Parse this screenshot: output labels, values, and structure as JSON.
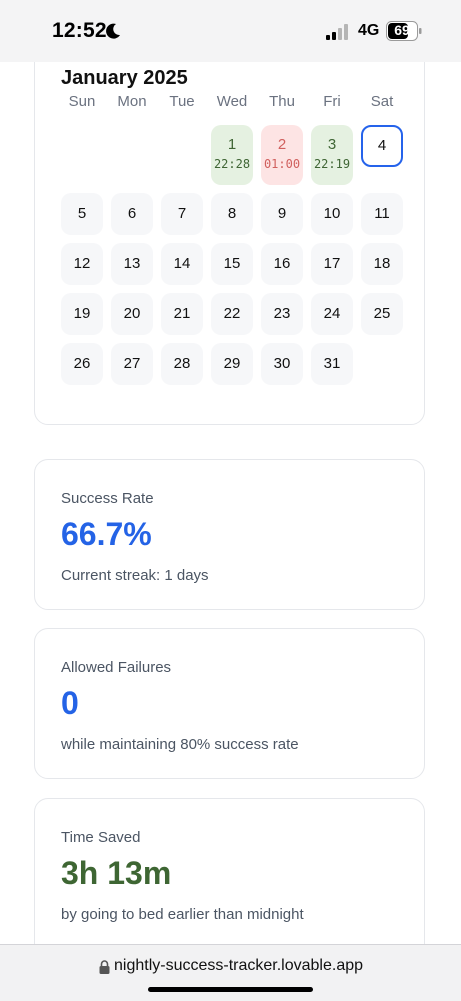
{
  "status_bar": {
    "time": "12:52",
    "network": "4G",
    "battery": "69"
  },
  "calendar": {
    "month": "January 2025",
    "weekdays": [
      "Sun",
      "Mon",
      "Tue",
      "Wed",
      "Thu",
      "Fri",
      "Sat"
    ],
    "days": [
      {
        "num": "1",
        "time": "22:28",
        "status": "success"
      },
      {
        "num": "2",
        "time": "01:00",
        "status": "fail"
      },
      {
        "num": "3",
        "time": "22:19",
        "status": "success"
      },
      {
        "num": "4",
        "status": "today"
      },
      {
        "num": "5"
      },
      {
        "num": "6"
      },
      {
        "num": "7"
      },
      {
        "num": "8"
      },
      {
        "num": "9"
      },
      {
        "num": "10"
      },
      {
        "num": "11"
      },
      {
        "num": "12"
      },
      {
        "num": "13"
      },
      {
        "num": "14"
      },
      {
        "num": "15"
      },
      {
        "num": "16"
      },
      {
        "num": "17"
      },
      {
        "num": "18"
      },
      {
        "num": "19"
      },
      {
        "num": "20"
      },
      {
        "num": "21"
      },
      {
        "num": "22"
      },
      {
        "num": "23"
      },
      {
        "num": "24"
      },
      {
        "num": "25"
      },
      {
        "num": "26"
      },
      {
        "num": "27"
      },
      {
        "num": "28"
      },
      {
        "num": "29"
      },
      {
        "num": "30"
      },
      {
        "num": "31"
      }
    ]
  },
  "stats": {
    "success_rate": {
      "label": "Success Rate",
      "value": "66.7%",
      "sub": "Current streak: 1 days"
    },
    "allowed_failures": {
      "label": "Allowed Failures",
      "value": "0",
      "sub": "while maintaining 80% success rate"
    },
    "time_saved": {
      "label": "Time Saved",
      "value": "3h 13m",
      "sub": "by going to bed earlier than midnight"
    }
  },
  "browser": {
    "url": "nightly-success-tracker.lovable.app"
  },
  "colors": {
    "accent_blue": "#2463e6",
    "success_green": "#3e6633",
    "success_bg": "#e5f1e1",
    "fail_red": "#d0605e",
    "fail_bg": "#fde4e4"
  }
}
